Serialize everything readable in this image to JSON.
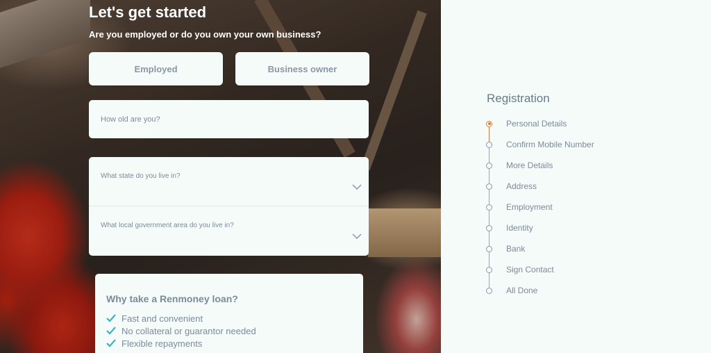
{
  "form": {
    "title": "Let's get started",
    "question": "Are you employed or do you own your own business?",
    "choices": [
      "Employed",
      "Business owner"
    ],
    "age_placeholder": "How old are you?",
    "state_placeholder": "What state do you live in?",
    "lga_placeholder": "What local government area do you live in?"
  },
  "why": {
    "heading": "Why take a Renmoney loan?",
    "items": [
      "Fast and convenient",
      "No collateral or guarantor needed",
      "Flexible repayments"
    ]
  },
  "registration": {
    "title": "Registration",
    "steps": [
      "Personal Details",
      "Confirm Mobile Number",
      "More Details",
      "Address",
      "Employment",
      "Identity",
      "Bank",
      "Sign Contact",
      "All Done"
    ],
    "active_step": 0
  },
  "colors": {
    "accent": "#e07a3e",
    "check": "#3bb3c3",
    "muted_text": "#7d8a99",
    "card_bg": "#f4fbf8"
  }
}
